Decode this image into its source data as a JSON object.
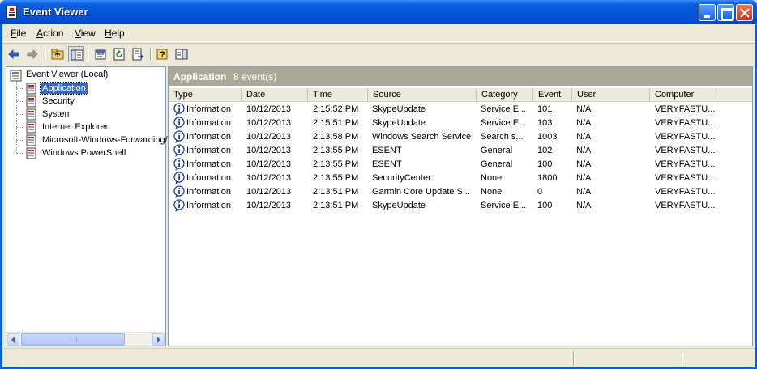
{
  "window": {
    "title": "Event Viewer"
  },
  "menu": {
    "items": [
      {
        "label": "File",
        "u": "F",
        "rest": "ile"
      },
      {
        "label": "Action",
        "u": "A",
        "rest": "ction"
      },
      {
        "label": "View",
        "u": "V",
        "rest": "iew"
      },
      {
        "label": "Help",
        "u": "H",
        "rest": "elp"
      }
    ]
  },
  "toolbar": {
    "buttons": [
      "back-arrow-icon",
      "forward-arrow-icon",
      "up-folder-icon",
      "show-hide-tree-icon",
      "properties-icon",
      "refresh-icon",
      "export-list-icon",
      "help-icon",
      "console-tree-icon"
    ]
  },
  "tree": {
    "root": "Event Viewer (Local)",
    "nodes": [
      "Application",
      "Security",
      "System",
      "Internet Explorer",
      "Microsoft-Windows-Forwarding/",
      "Windows PowerShell"
    ],
    "selected": "Application"
  },
  "list": {
    "title": "Application",
    "count": "8 event(s)",
    "columns": [
      "Type",
      "Date",
      "Time",
      "Source",
      "Category",
      "Event",
      "User",
      "Computer"
    ],
    "rows": [
      {
        "type": "Information",
        "date": "10/12/2013",
        "time": "2:15:52 PM",
        "source": "SkypeUpdate",
        "category": "Service E...",
        "event": "101",
        "user": "N/A",
        "computer": "VERYFASTU..."
      },
      {
        "type": "Information",
        "date": "10/12/2013",
        "time": "2:15:51 PM",
        "source": "SkypeUpdate",
        "category": "Service E...",
        "event": "103",
        "user": "N/A",
        "computer": "VERYFASTU..."
      },
      {
        "type": "Information",
        "date": "10/12/2013",
        "time": "2:13:58 PM",
        "source": "Windows Search Service",
        "category": "Search s...",
        "event": "1003",
        "user": "N/A",
        "computer": "VERYFASTU..."
      },
      {
        "type": "Information",
        "date": "10/12/2013",
        "time": "2:13:55 PM",
        "source": "ESENT",
        "category": "General",
        "event": "102",
        "user": "N/A",
        "computer": "VERYFASTU..."
      },
      {
        "type": "Information",
        "date": "10/12/2013",
        "time": "2:13:55 PM",
        "source": "ESENT",
        "category": "General",
        "event": "100",
        "user": "N/A",
        "computer": "VERYFASTU..."
      },
      {
        "type": "Information",
        "date": "10/12/2013",
        "time": "2:13:55 PM",
        "source": "SecurityCenter",
        "category": "None",
        "event": "1800",
        "user": "N/A",
        "computer": "VERYFASTU..."
      },
      {
        "type": "Information",
        "date": "10/12/2013",
        "time": "2:13:51 PM",
        "source": "Garmin Core Update S...",
        "category": "None",
        "event": "0",
        "user": "N/A",
        "computer": "VERYFASTU..."
      },
      {
        "type": "Information",
        "date": "10/12/2013",
        "time": "2:13:51 PM",
        "source": "SkypeUpdate",
        "category": "Service E...",
        "event": "100",
        "user": "N/A",
        "computer": "VERYFASTU..."
      }
    ]
  },
  "colors": {
    "selection": "#316ac5",
    "titlebar": "#0a5ee0",
    "list_header": "#aca899"
  }
}
